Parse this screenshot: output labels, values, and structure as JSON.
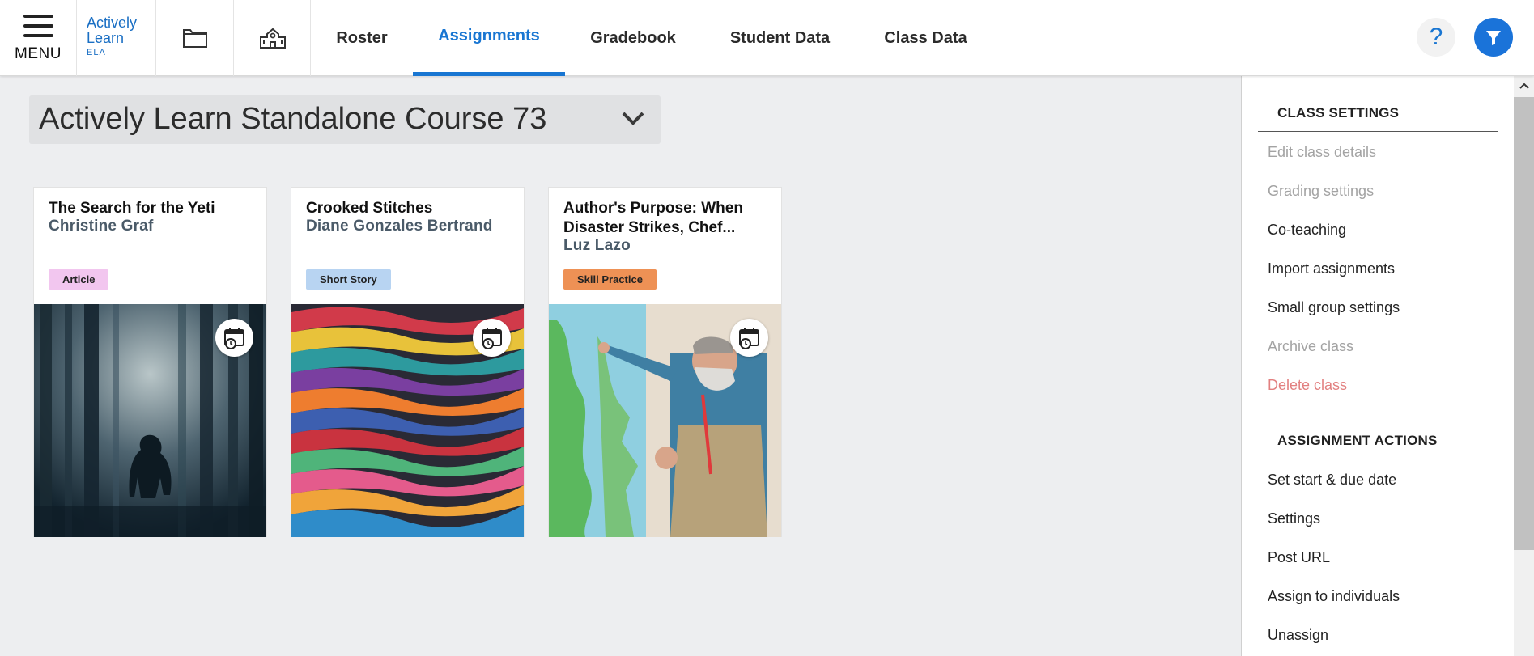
{
  "nav": {
    "menu_label": "MENU",
    "logo": {
      "line1": "Actively",
      "line2": "Learn",
      "line3": "ELA"
    },
    "tabs": [
      {
        "label": "Roster"
      },
      {
        "label": "Assignments",
        "active": true
      },
      {
        "label": "Gradebook"
      },
      {
        "label": "Student Data"
      },
      {
        "label": "Class Data"
      }
    ],
    "help_label": "?",
    "accent_color": "#1976d2"
  },
  "course": {
    "title": "Actively Learn Standalone Course 73"
  },
  "cards": [
    {
      "title": "The Search for the Yeti",
      "author": "Christine Graf",
      "type": "Article",
      "badge_color": "#f2c6ef",
      "image": "forest-yeti"
    },
    {
      "title": "Crooked Stitches",
      "author": "Diane Gonzales Bertrand",
      "type": "Short Story",
      "badge_color": "#b8d4f2",
      "image": "colorful-stitches"
    },
    {
      "title": "Author's Purpose: When Disaster Strikes, Chef...",
      "author": "Luz Lazo",
      "type": "Skill Practice",
      "badge_color": "#ee9155",
      "image": "chef-at-map"
    }
  ],
  "sidebar": {
    "class_settings": {
      "heading": "CLASS SETTINGS",
      "items": [
        {
          "label": "Edit class details",
          "state": "disabled"
        },
        {
          "label": "Grading settings",
          "state": "disabled"
        },
        {
          "label": "Co-teaching",
          "state": "enabled"
        },
        {
          "label": "Import assignments",
          "state": "enabled"
        },
        {
          "label": "Small group settings",
          "state": "enabled"
        },
        {
          "label": "Archive class",
          "state": "disabled"
        },
        {
          "label": "Delete class",
          "state": "danger"
        }
      ]
    },
    "assignment_actions": {
      "heading": "ASSIGNMENT ACTIONS",
      "items": [
        {
          "label": "Set start & due date"
        },
        {
          "label": "Settings"
        },
        {
          "label": "Post URL"
        },
        {
          "label": "Assign to individuals"
        },
        {
          "label": "Unassign"
        }
      ]
    }
  }
}
